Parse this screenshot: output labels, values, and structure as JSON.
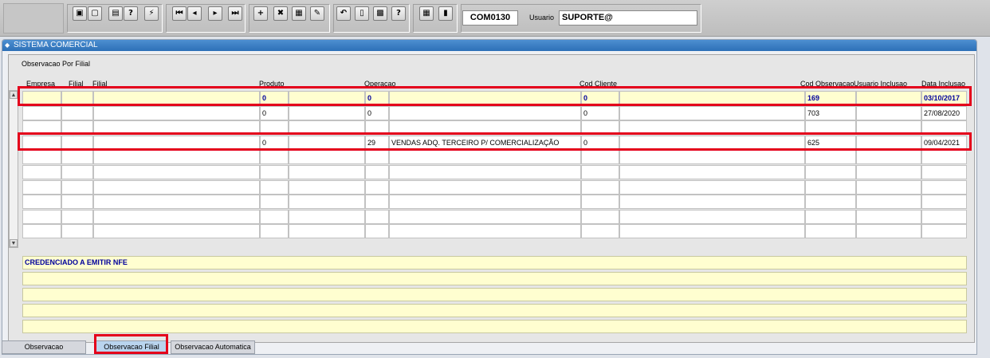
{
  "toolbar": {
    "form_code": "COM0130",
    "user_label": "Usuario",
    "user_value": "SUPORTE@",
    "buttons": [
      {
        "name": "save-button",
        "glyph": "▣"
      },
      {
        "name": "print-preview-button",
        "glyph": "▢"
      },
      {
        "name": "print-button",
        "glyph": "▤"
      },
      {
        "name": "query-button",
        "glyph": "?"
      },
      {
        "name": "execute-query-button",
        "glyph": "⚡"
      },
      {
        "name": "first-record-button",
        "glyph": "⏮"
      },
      {
        "name": "previous-record-button",
        "glyph": "◂"
      },
      {
        "name": "next-record-button",
        "glyph": "▸"
      },
      {
        "name": "last-record-button",
        "glyph": "⏭"
      },
      {
        "name": "insert-record-button",
        "glyph": "+"
      },
      {
        "name": "delete-record-button",
        "glyph": "✖"
      },
      {
        "name": "duplicate-record-button",
        "glyph": "▦"
      },
      {
        "name": "clear-button",
        "glyph": "✎"
      },
      {
        "name": "undo-button",
        "glyph": "↶"
      },
      {
        "name": "copy-button",
        "glyph": "▯"
      },
      {
        "name": "list-values-button",
        "glyph": "▩"
      },
      {
        "name": "help-button",
        "glyph": "?"
      },
      {
        "name": "menu-button",
        "glyph": "▦"
      },
      {
        "name": "exit-button",
        "glyph": "▮"
      }
    ]
  },
  "window": {
    "title": "SISTEMA COMERCIAL",
    "panel_title": "Observacao Por Filial"
  },
  "columns": [
    "Empresa",
    "Filial",
    "Filial",
    "Produto",
    "Operacao",
    "Cod Cliente",
    "Cod Observacao",
    "Usuario Inclusao",
    "Data Inclusao"
  ],
  "rows": [
    {
      "empresa": "",
      "filial_cod": "",
      "filial_nome": "",
      "produto": "0",
      "produto_desc": "",
      "operacao": "0",
      "operacao_desc": "",
      "cod_cliente": "0",
      "cliente_nome": "",
      "cod_observacao": "169",
      "usuario_inclusao": "",
      "data_inclusao": "03/10/2017"
    },
    {
      "empresa": "",
      "filial_cod": "",
      "filial_nome": "",
      "produto": "0",
      "produto_desc": "",
      "operacao": "0",
      "operacao_desc": "",
      "cod_cliente": "0",
      "cliente_nome": "",
      "cod_observacao": "703",
      "usuario_inclusao": "",
      "data_inclusao": "27/08/2020"
    },
    {
      "empresa": "",
      "filial_cod": "",
      "filial_nome": "",
      "produto": "",
      "produto_desc": "",
      "operacao": "",
      "operacao_desc": "",
      "cod_cliente": "",
      "cliente_nome": "",
      "cod_observacao": "",
      "usuario_inclusao": "",
      "data_inclusao": ""
    },
    {
      "empresa": "",
      "filial_cod": "",
      "filial_nome": "",
      "produto": "0",
      "produto_desc": "",
      "operacao": "29",
      "operacao_desc": "VENDAS ADQ. TERCEIRO  P/ COMERCIALIZAÇÃO",
      "cod_cliente": "0",
      "cliente_nome": "",
      "cod_observacao": "625",
      "usuario_inclusao": "",
      "data_inclusao": "09/04/2021"
    },
    {
      "empresa": "",
      "filial_cod": "",
      "filial_nome": "",
      "produto": "",
      "produto_desc": "",
      "operacao": "",
      "operacao_desc": "",
      "cod_cliente": "",
      "cliente_nome": "",
      "cod_observacao": "",
      "usuario_inclusao": "",
      "data_inclusao": ""
    },
    {
      "empresa": "",
      "filial_cod": "",
      "filial_nome": "",
      "produto": "",
      "produto_desc": "",
      "operacao": "",
      "operacao_desc": "",
      "cod_cliente": "",
      "cliente_nome": "",
      "cod_observacao": "",
      "usuario_inclusao": "",
      "data_inclusao": ""
    },
    {
      "empresa": "",
      "filial_cod": "",
      "filial_nome": "",
      "produto": "",
      "produto_desc": "",
      "operacao": "",
      "operacao_desc": "",
      "cod_cliente": "",
      "cliente_nome": "",
      "cod_observacao": "",
      "usuario_inclusao": "",
      "data_inclusao": ""
    },
    {
      "empresa": "",
      "filial_cod": "",
      "filial_nome": "",
      "produto": "",
      "produto_desc": "",
      "operacao": "",
      "operacao_desc": "",
      "cod_cliente": "",
      "cliente_nome": "",
      "cod_observacao": "",
      "usuario_inclusao": "",
      "data_inclusao": ""
    },
    {
      "empresa": "",
      "filial_cod": "",
      "filial_nome": "",
      "produto": "",
      "produto_desc": "",
      "operacao": "",
      "operacao_desc": "",
      "cod_cliente": "",
      "cliente_nome": "",
      "cod_observacao": "",
      "usuario_inclusao": "",
      "data_inclusao": ""
    },
    {
      "empresa": "",
      "filial_cod": "",
      "filial_nome": "",
      "produto": "",
      "produto_desc": "",
      "operacao": "",
      "operacao_desc": "",
      "cod_cliente": "",
      "cliente_nome": "",
      "cod_observacao": "",
      "usuario_inclusao": "",
      "data_inclusao": ""
    }
  ],
  "observation_lines": [
    "CREDENCIADO A EMITIR NFE",
    "",
    "",
    "",
    ""
  ],
  "tabs": [
    {
      "label": "Observacao",
      "active": false
    },
    {
      "label": "Observacao Filial",
      "active": true
    },
    {
      "label": "Observacao Automatica",
      "active": false
    }
  ],
  "colors": {
    "current_row_bg": "#fffed0",
    "current_row_text": "#00009c",
    "title_bar": "#2d70b7",
    "highlight": "#e4001b"
  }
}
